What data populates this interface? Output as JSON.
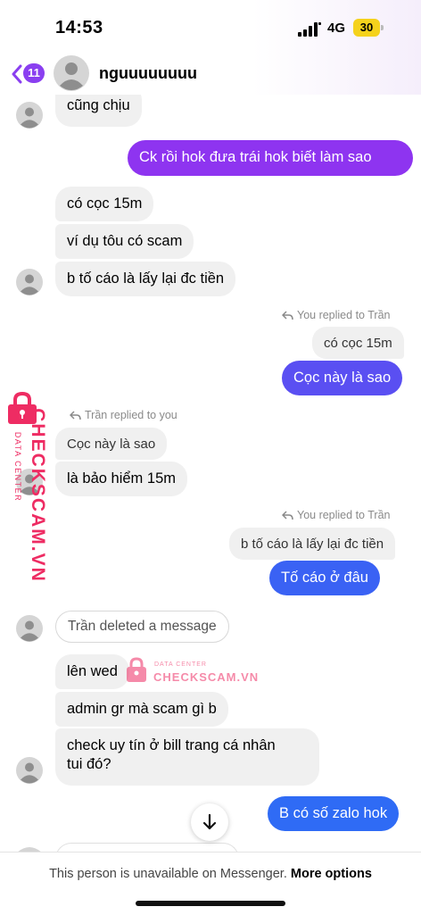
{
  "status_bar": {
    "time": "14:53",
    "network": "4G",
    "battery": "30"
  },
  "header": {
    "unread_count": "11",
    "contact_name": "nguuuuuuuu"
  },
  "messages": [
    {
      "side": "in",
      "text": "cũng chịu"
    },
    {
      "side": "out",
      "text": "Ck rồi hok đưa trái hok biết làm sao"
    },
    {
      "side": "in",
      "text": "có cọc 15m"
    },
    {
      "side": "in",
      "text": "ví dụ tôu có scam"
    },
    {
      "side": "in",
      "text": "b tố cáo là lấy lại đc tiền"
    },
    {
      "side": "reply_note",
      "text": "You replied to Trần"
    },
    {
      "side": "quoted",
      "text": "có cọc 15m"
    },
    {
      "side": "out",
      "text": "Cọc này là sao"
    },
    {
      "side": "reply_note",
      "text": "Trần replied to you"
    },
    {
      "side": "quoted",
      "text": "Cọc này là sao"
    },
    {
      "side": "in",
      "text": "là bảo hiểm 15m"
    },
    {
      "side": "reply_note",
      "text": "You replied to Trần"
    },
    {
      "side": "quoted",
      "text": "b tố cáo là lấy lại đc tiền"
    },
    {
      "side": "out",
      "text": "Tố cáo ở đâu"
    },
    {
      "side": "deleted",
      "text": "Trần deleted a message"
    },
    {
      "side": "in",
      "text": "lên wed"
    },
    {
      "side": "in",
      "text": "admin gr mà scam gì b"
    },
    {
      "side": "in",
      "text_lines": [
        "check uy tín ở bill trang cá nhân",
        "tui đó?"
      ]
    },
    {
      "side": "out",
      "text": "B có số zalo hok"
    }
  ],
  "watermark": {
    "brand": "CHECKSCAM.VN",
    "tagline": "DATA CENTER",
    "color": "#ee2c63"
  },
  "footer": {
    "notice": "This person is unavailable on Messenger.",
    "link": "More options"
  },
  "icons": {
    "back": "chevron-left-icon",
    "reply": "reply-arrow-icon",
    "scroll_down": "arrow-down-icon",
    "avatar": "default-avatar-icon"
  },
  "colors": {
    "outgoing_purple": "#8e34f0",
    "outgoing_indigo": "#5a4ff2",
    "outgoing_blue": "#2f6bf5",
    "incoming": "#f0f0f0"
  }
}
